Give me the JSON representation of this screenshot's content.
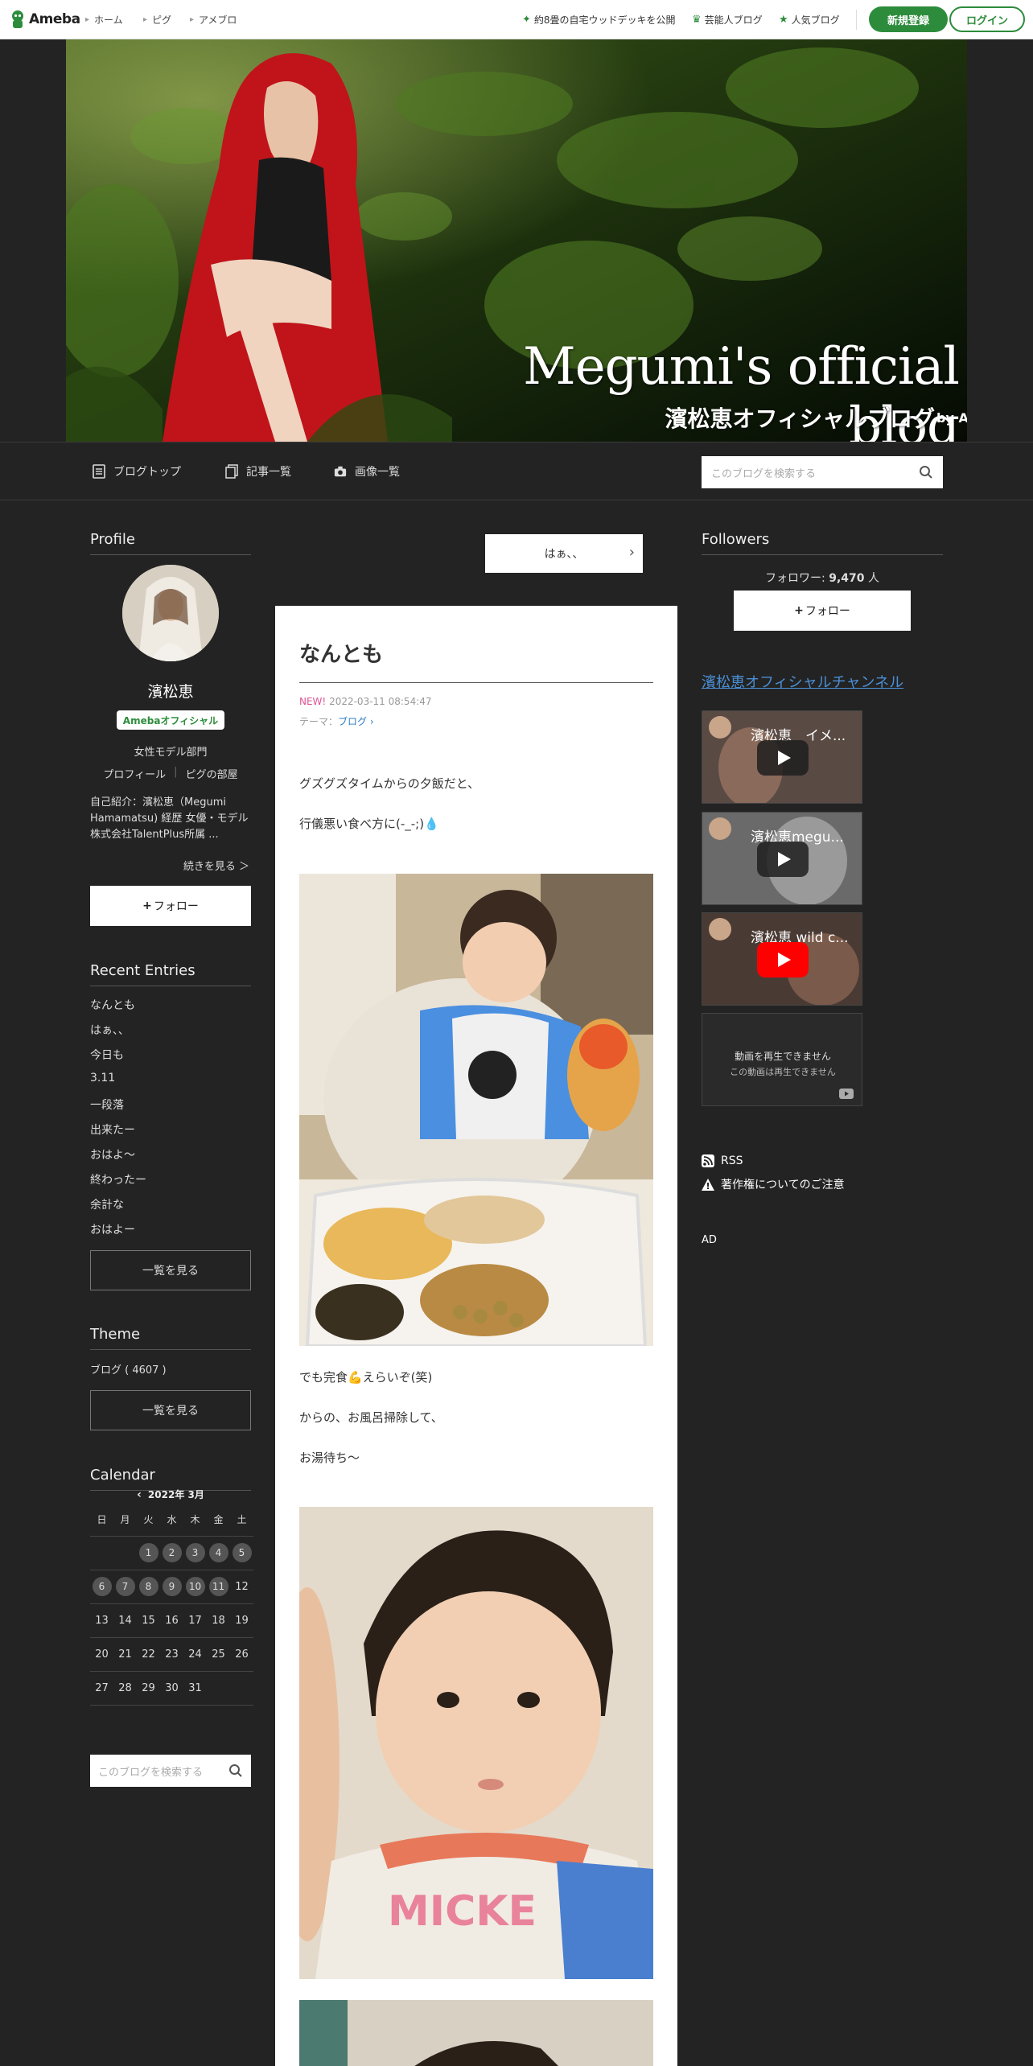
{
  "topbar": {
    "logo_text": "Ameba",
    "nav_left": [
      "ホーム",
      "ピグ",
      "アメブロ"
    ],
    "nav_right": [
      {
        "icon": "sparkle-icon",
        "label": "約8畳の自宅ウッドデッキを公開"
      },
      {
        "icon": "crown-icon",
        "label": "芸能人ブログ"
      },
      {
        "icon": "star-icon",
        "label": "人気ブログ"
      }
    ],
    "register_label": "新規登録",
    "login_label": "ログイン"
  },
  "header": {
    "title": "Megumi's official blog",
    "subtitle": "濱松恵オフィシャルブログ",
    "by": "by Ameba."
  },
  "global_nav": {
    "items": [
      {
        "icon": "document-icon",
        "label": "ブログトップ"
      },
      {
        "icon": "copy-icon",
        "label": "記事一覧"
      },
      {
        "icon": "camera-icon",
        "label": "画像一覧"
      }
    ],
    "search_placeholder": "このブログを検索する"
  },
  "profile": {
    "heading": "Profile",
    "name": "濱松恵",
    "badge": "Amebaオフィシャル",
    "category": "女性モデル部門",
    "links": [
      "プロフィール",
      "ピグの部屋"
    ],
    "intro": "自己紹介：濱松恵（Megumi Hamamatsu) 経歴 女優・モデル 株式会社TalentPlus所属 ...",
    "more": "続きを見る ＞",
    "follow": "フォロー"
  },
  "recent": {
    "heading": "Recent Entries",
    "items": [
      "なんとも",
      "はぁ、、",
      "今日も",
      "3.11",
      "一段落",
      "出来たー",
      "おはよ～",
      "終わったー",
      "余計な",
      "おはよー"
    ],
    "more": "一覧を見る"
  },
  "theme": {
    "heading": "Theme",
    "item": "ブログ ( 4607 )",
    "more": "一覧を見る"
  },
  "calendar": {
    "heading": "Calendar",
    "month": "2022年 3月",
    "weekdays": [
      "日",
      "月",
      "火",
      "水",
      "木",
      "金",
      "土"
    ],
    "weeks": [
      [
        "",
        "",
        "1",
        "2",
        "3",
        "4",
        "5"
      ],
      [
        "6",
        "7",
        "8",
        "9",
        "10",
        "11",
        "12"
      ],
      [
        "13",
        "14",
        "15",
        "16",
        "17",
        "18",
        "19"
      ],
      [
        "20",
        "21",
        "22",
        "23",
        "24",
        "25",
        "26"
      ],
      [
        "27",
        "28",
        "29",
        "30",
        "31",
        "",
        ""
      ]
    ],
    "posted_days": [
      "1",
      "2",
      "3",
      "4",
      "5",
      "6",
      "7",
      "8",
      "9",
      "10",
      "11"
    ]
  },
  "left_search_placeholder": "このブログを検索する",
  "prev_entry": "はぁ、、",
  "article": {
    "title": "なんとも",
    "new_label": "NEW!",
    "date": "2022-03-11 08:54:47",
    "theme_label": "テーマ：",
    "theme_link": "ブログ",
    "p1": "グズグズタイムからの夕飯だと、",
    "p2": "行儀悪い食べ方に(-_-;)💧",
    "p3": "でも完食💪えらいぞ(笑)",
    "p4": "からの、お風呂掃除して、",
    "p5": "お湯待ち～"
  },
  "followers": {
    "heading": "Followers",
    "count_label": "フォロワー:",
    "count": "9,470",
    "unit": "人",
    "follow": "フォロー"
  },
  "channel": {
    "link": "濱松恵オフィシャルチャンネル",
    "videos": [
      "濱松恵　イメ...",
      "濱松恵megu...",
      "濱松恵 wild c..."
    ],
    "unavailable_1": "動画を再生できません",
    "unavailable_2": "この動画は再生できません"
  },
  "right_links": {
    "rss": "RSS",
    "copyright": "著作権についてのご注意",
    "ad": "AD"
  },
  "colors": {
    "ameba_green": "#2d8c3c",
    "background": "#232323",
    "new_pink": "#e05493",
    "link_blue": "#4a8fd6"
  }
}
